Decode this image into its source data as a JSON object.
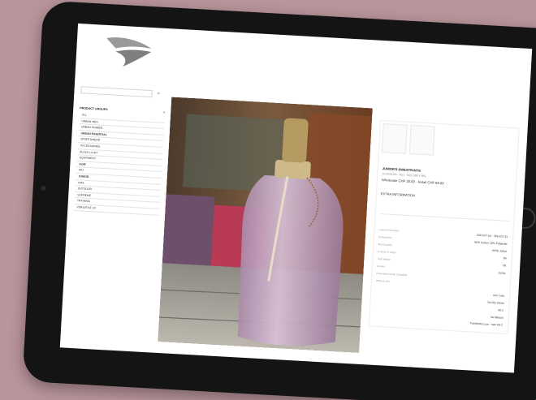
{
  "search": {
    "placeholder": ""
  },
  "sidebar": {
    "title": "PRODUCT GROUPS",
    "toggle": "^",
    "items": [
      {
        "label": "ALL",
        "bold": false
      },
      {
        "label": "URBAN MEN",
        "bold": false
      },
      {
        "label": "URBAN WOMEN",
        "bold": false
      },
      {
        "label": "URBAN ESSENTIAL",
        "bold": true
      },
      {
        "label": "SPORTSWEAR",
        "bold": false
      },
      {
        "label": "ACCESSORIES",
        "bold": false
      },
      {
        "label": "BLACK LIGHT",
        "bold": false
      },
      {
        "label": "EQUIPMENT",
        "bold": false
      },
      {
        "label": "GGM",
        "bold": true
      },
      {
        "label": "HIIJ",
        "bold": false
      },
      {
        "label": "JUNIOR",
        "bold": true
      },
      {
        "label": "NITA",
        "bold": false
      },
      {
        "label": "OUTDOOR",
        "bold": false
      },
      {
        "label": "SUPREME",
        "bold": false
      },
      {
        "label": "TRAINING",
        "bold": false
      },
      {
        "label": "VERSATILE 3X",
        "bold": false
      }
    ]
  },
  "product": {
    "name": "JUNIOR'S SWEATPANTS",
    "code": "JC23201130 · M21 · M21 GREY MEL",
    "price": "Wholesale CHF 30.00 · Retail CHF 69.00",
    "extra_title": "EXTRA INFORMATION",
    "specs": [
      {
        "label": "Launch Decoration",
        "value": "2013-07-1st - 2013-07-31"
      },
      {
        "label": "Composition",
        "value": "80% Cotton 20% Polyester"
      },
      {
        "label": "Brand quality",
        "value": "KIRK Junior"
      },
      {
        "label": "Country of Origin",
        "value": "TR"
      },
      {
        "label": "Total Weight",
        "value": "TR"
      },
      {
        "label": "Gender",
        "value": "Junior"
      },
      {
        "label": "Downside Include Cancelled",
        "value": ""
      },
      {
        "label": "Wash & care",
        "value": ""
      }
    ],
    "care": [
      "Iron 2 dot",
      "No Dry Clean",
      "40 C",
      "No Bleach",
      "Tumbledry Low - max 60 C"
    ]
  },
  "colors": {
    "page_background": "#b8959b",
    "tablet_bezel": "#141414",
    "logo_gray": "#8c8c8c"
  }
}
